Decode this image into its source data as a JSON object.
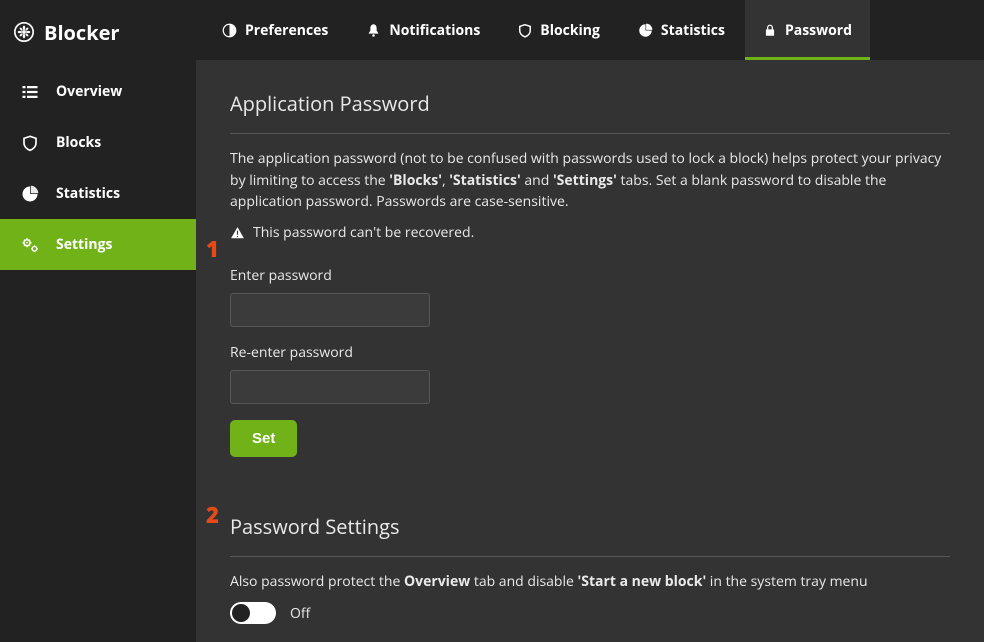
{
  "app": {
    "name": "Blocker"
  },
  "sidebar": {
    "items": [
      {
        "label": "Overview"
      },
      {
        "label": "Blocks"
      },
      {
        "label": "Statistics"
      },
      {
        "label": "Settings"
      }
    ]
  },
  "tabs": [
    {
      "label": "Preferences"
    },
    {
      "label": "Notifications"
    },
    {
      "label": "Blocking"
    },
    {
      "label": "Statistics"
    },
    {
      "label": "Password"
    }
  ],
  "password_section": {
    "title": "Application Password",
    "desc_pre": "The application password (not to be confused with passwords used to lock a block) helps protect your privacy by limiting to access the ",
    "desc_b1": "'Blocks'",
    "desc_mid1": ", ",
    "desc_b2": "'Statistics'",
    "desc_mid2": " and ",
    "desc_b3": "'Settings'",
    "desc_post": " tabs. Set a blank password to disable the application password. Passwords are case-sensitive.",
    "warning": "This password can't be recovered.",
    "enter_label": "Enter password",
    "reenter_label": "Re-enter password",
    "set_button": "Set"
  },
  "settings_section": {
    "title": "Password Settings",
    "row_pre": "Also password protect the ",
    "row_b1": "Overview",
    "row_mid": " tab and disable ",
    "row_b2": "'Start a new block'",
    "row_post": " in the system tray menu",
    "toggle_state": "Off"
  },
  "annotations": {
    "one": "1",
    "two": "2"
  }
}
